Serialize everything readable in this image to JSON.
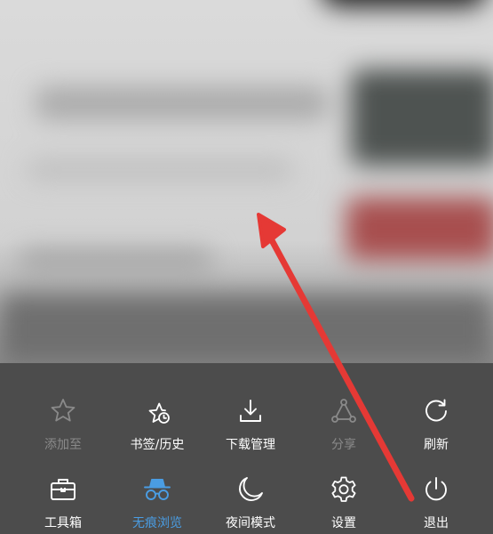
{
  "menu": {
    "items": [
      {
        "label": "添加至",
        "icon": "star-outline-icon",
        "state": "disabled"
      },
      {
        "label": "书签/历史",
        "icon": "star-clock-icon",
        "state": "normal"
      },
      {
        "label": "下载管理",
        "icon": "download-icon",
        "state": "normal"
      },
      {
        "label": "分享",
        "icon": "share-icon",
        "state": "disabled"
      },
      {
        "label": "刷新",
        "icon": "refresh-icon",
        "state": "normal"
      },
      {
        "label": "工具箱",
        "icon": "toolbox-icon",
        "state": "normal"
      },
      {
        "label": "无痕浏览",
        "icon": "incognito-icon",
        "state": "active"
      },
      {
        "label": "夜间模式",
        "icon": "moon-icon",
        "state": "normal"
      },
      {
        "label": "设置",
        "icon": "gear-icon",
        "state": "normal"
      },
      {
        "label": "退出",
        "icon": "power-icon",
        "state": "normal"
      }
    ]
  },
  "colors": {
    "panel_background": "#4c4c4c",
    "active_blue": "#4a9de3",
    "disabled_gray": "#8a8a8a",
    "annotation_red": "#e53935"
  }
}
